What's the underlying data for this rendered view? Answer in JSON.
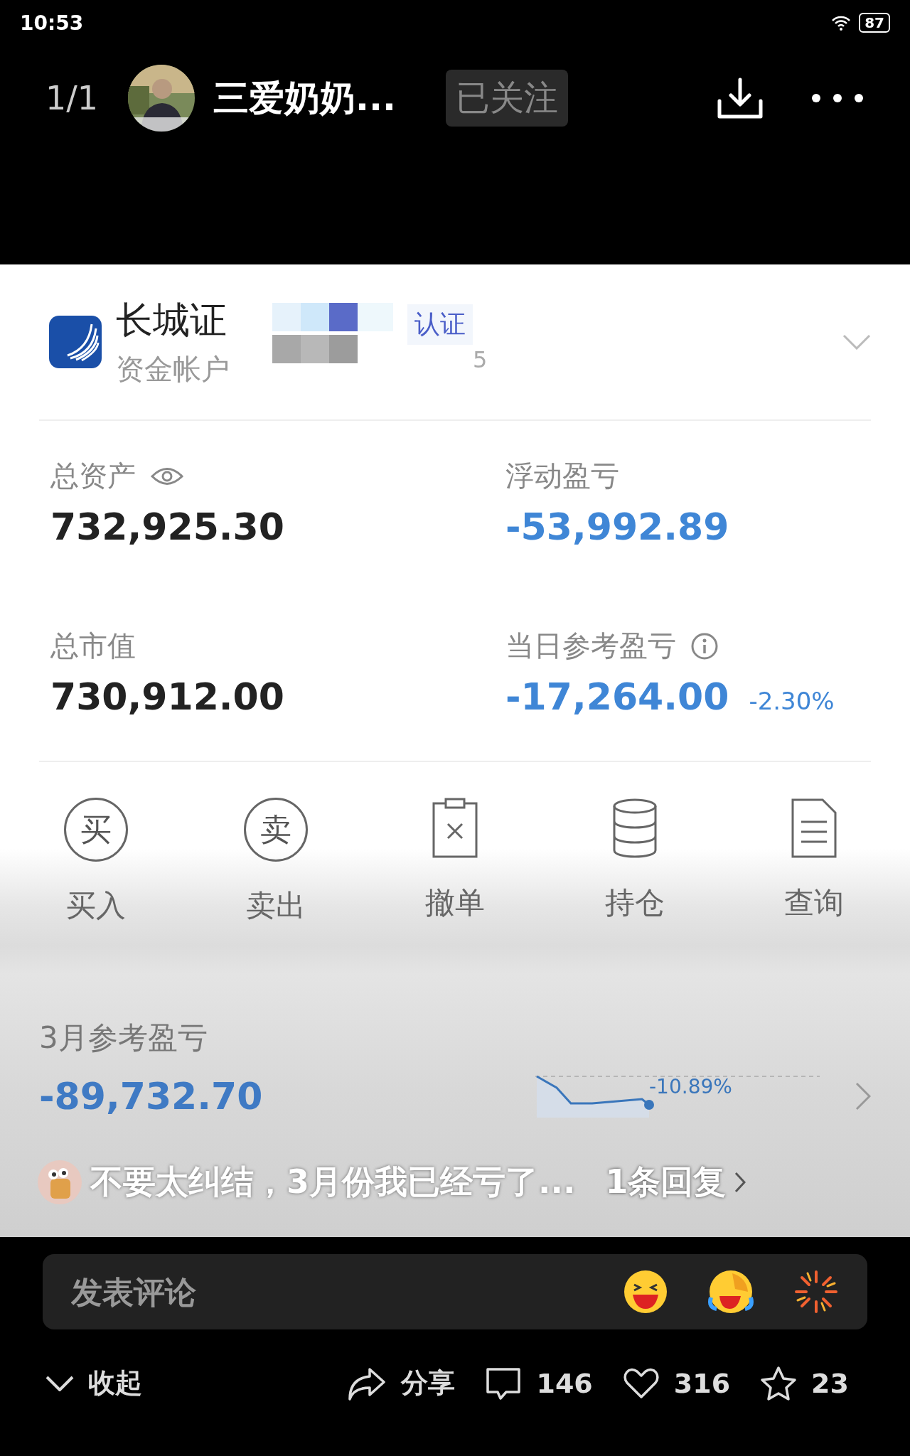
{
  "status_bar": {
    "time": "10:53",
    "battery": "87"
  },
  "header": {
    "page": "1/1",
    "author": "三爱奶奶...",
    "follow": {
      "label": "已关注",
      "selected": true
    }
  },
  "image": {
    "account": {
      "broker": "长城证",
      "account_label": "资金帐户",
      "tag": "认证",
      "digit": "5"
    },
    "stats": [
      {
        "label": "总资产",
        "value": "732,925.30",
        "negative": false,
        "kind": "eye"
      },
      {
        "label": "浮动盈亏",
        "value": "-53,992.89",
        "negative": true,
        "kind": "plain"
      },
      {
        "label": "总市值",
        "value": "730,912.00",
        "negative": false,
        "kind": "plain"
      },
      {
        "label": "当日参考盈亏",
        "value": "-17,264.00",
        "negative": true,
        "kind": "info",
        "change": "-2.30%"
      }
    ],
    "actions": [
      {
        "label": "买入",
        "kind": "circle",
        "glyph": "买"
      },
      {
        "label": "卖出",
        "kind": "circle",
        "glyph": "卖"
      },
      {
        "label": "撤单",
        "kind": "cancel"
      },
      {
        "label": "持仓",
        "kind": "database"
      },
      {
        "label": "查询",
        "kind": "document"
      }
    ],
    "monthly": {
      "title": "3月参考盈亏",
      "value": "-89,732.70",
      "change": "-10.89%"
    }
  },
  "comment_preview": {
    "text": "不要太纠结，3月份我已经亏了...",
    "replies": "1条回复"
  },
  "comment_box": {
    "placeholder": "发表评论"
  },
  "footer": {
    "collapse": "收起",
    "share": "分享",
    "comments": "146",
    "likes": "316",
    "favorites": "23"
  }
}
